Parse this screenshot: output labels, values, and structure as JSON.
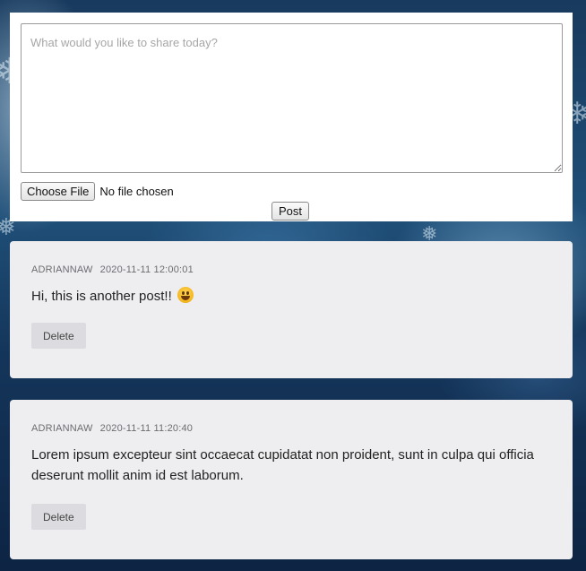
{
  "composer": {
    "placeholder": "What would you like to share today?",
    "choose_file_label": "Choose File",
    "file_status": "No file chosen",
    "post_label": "Post"
  },
  "posts": [
    {
      "author": "ADRIANNAW",
      "timestamp": "2020-11-11 12:00:01",
      "body": "Hi, this is another post!!",
      "emoji": "grinning-face",
      "delete_label": "Delete"
    },
    {
      "author": "ADRIANNAW",
      "timestamp": "2020-11-11 11:20:40",
      "body": "Lorem ipsum excepteur sint occaecat cupidatat non proident, sunt in culpa qui officia deserunt mollit anim id est laborum.",
      "delete_label": "Delete"
    }
  ]
}
